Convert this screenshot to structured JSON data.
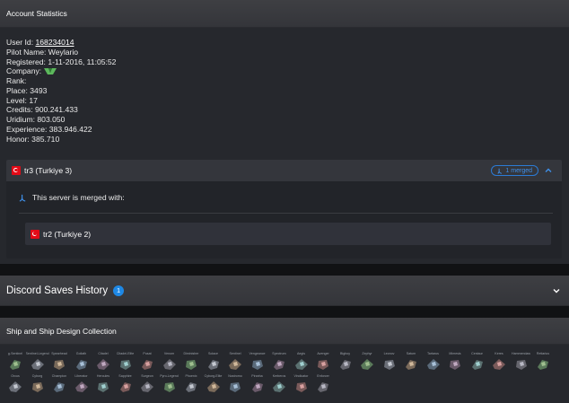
{
  "account": {
    "title": "Account Statistics",
    "user_id_label": "User Id: ",
    "user_id": "168234014",
    "pilot_name": "Pilot Name: Weylario",
    "registered": "Registered: 1-11-2016, 11:05:52",
    "company": "Company: ",
    "rank": "Rank:",
    "place": "Place: 3493",
    "level": "Level: 17",
    "credits": "Credits: 900.241.433",
    "uridium": "Uridium: 803.050",
    "experience": "Experience: 383.946.422",
    "honor": "Honor: 385.710"
  },
  "server": {
    "name": "tr3 (Turkiye 3)",
    "merged_badge": "1 merged",
    "merged_info": "This server is merged with:",
    "merged_servers": [
      "tr2 (Turkiye 2)"
    ]
  },
  "discord": {
    "title": "Discord Saves History",
    "count": "1"
  },
  "ships": {
    "title": "Ship and Ship Design Collection",
    "items": [
      "g-Sentinel",
      "Sentinel-Legend",
      "Spearhead",
      "Goliath",
      "Citadel",
      "Citadel-Elite",
      "Pusat",
      "Venom",
      "Diminisher",
      "Solace",
      "Sentinel",
      "Vengeance",
      "Spectrum",
      "Aegis",
      "Avenger",
      "Bigboy",
      "Zephyr",
      "Leonov",
      "Saturn",
      "Tartarus",
      "Mimesis",
      "Centaur",
      "Keres",
      "Hammerclaw",
      "Retiarius",
      "Orcus",
      "Cyborg",
      "Champion",
      "Liberator",
      "Hercules",
      "Sapphire",
      "Surgeon",
      "Pyro-Legend",
      "Phoenix",
      "Cyborg-Elite",
      "Nostromo",
      "Piranha",
      "Kerberos",
      "Vindicator",
      "Enforcer"
    ]
  },
  "colors": {
    "accent": "#1e88e5",
    "turkey_red": "#e30a17"
  }
}
